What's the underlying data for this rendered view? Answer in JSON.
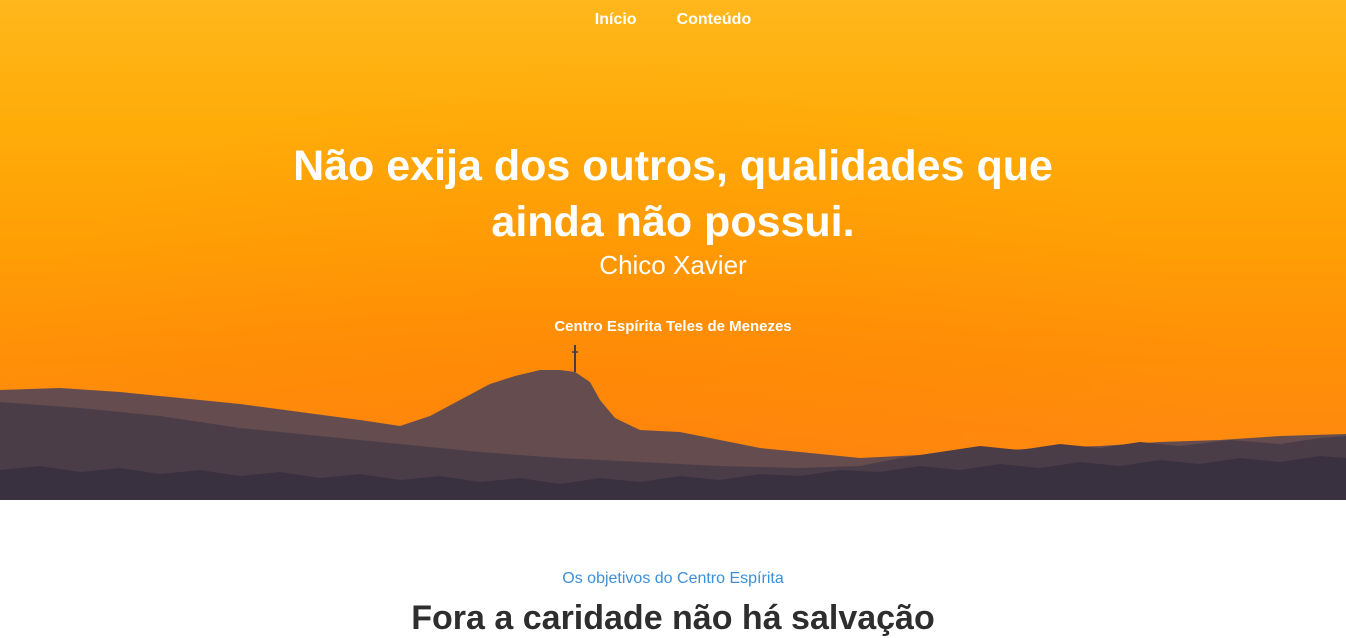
{
  "nav": {
    "items": [
      {
        "label": "Início"
      },
      {
        "label": "Conteúdo"
      }
    ]
  },
  "hero": {
    "quote": "Não exija dos outros, qualidades que ainda não possui.",
    "author": "Chico Xavier",
    "organization": "Centro Espírita Teles de Menezes"
  },
  "objectives": {
    "kicker": "Os objetivos do Centro Espírita",
    "heading": "Fora a caridade não há salvação"
  },
  "colors": {
    "sky_top": "#ffb71c",
    "sky_bottom": "#ff8514",
    "hills_dark": "#3e3440",
    "hills_mid": "#5e4c52",
    "accent_blue": "#3d8fd6"
  }
}
